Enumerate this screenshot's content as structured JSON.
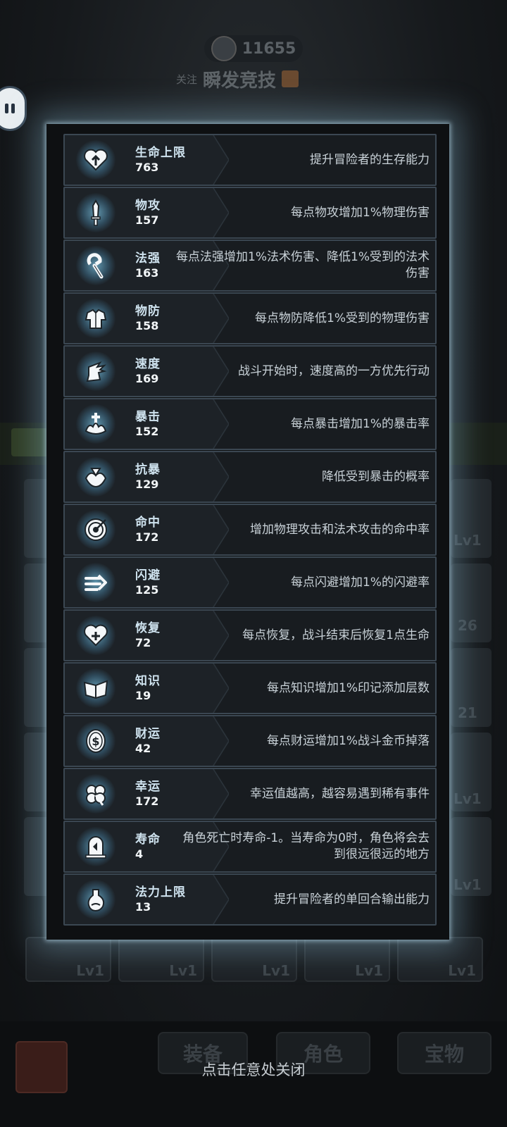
{
  "background": {
    "coins": "11655",
    "follow_label": "关注",
    "mode_name": "瞬发竞技",
    "slot_levels": [
      "Lv1",
      "26",
      "21",
      "Lv1",
      "Lv1"
    ],
    "bottom_row_levels": [
      "Lv1",
      "Lv1",
      "Lv1",
      "Lv1",
      "Lv1"
    ],
    "nav_tabs": [
      "装备",
      "角色",
      "宝物"
    ]
  },
  "stats": [
    {
      "icon": "heart-up-icon",
      "name": "生命上限",
      "value": "763",
      "desc": "提升冒险者的生存能力"
    },
    {
      "icon": "sword-icon",
      "name": "物攻",
      "value": "157",
      "desc": "每点物攻增加1%物理伤害"
    },
    {
      "icon": "staff-icon",
      "name": "法强",
      "value": "163",
      "desc": "每点法强增加1%法术伤害、降低1%受到的法术伤害"
    },
    {
      "icon": "armor-icon",
      "name": "物防",
      "value": "158",
      "desc": "每点物防降低1%受到的物理伤害"
    },
    {
      "icon": "winged-boot-icon",
      "name": "速度",
      "value": "169",
      "desc": "战斗开始时，速度高的一方优先行动"
    },
    {
      "icon": "crit-icon",
      "name": "暴击",
      "value": "152",
      "desc": "每点暴击增加1%的暴击率"
    },
    {
      "icon": "crit-resist-icon",
      "name": "抗暴",
      "value": "129",
      "desc": "降低受到暴击的概率"
    },
    {
      "icon": "target-icon",
      "name": "命中",
      "value": "172",
      "desc": "增加物理攻击和法术攻击的命中率"
    },
    {
      "icon": "dodge-icon",
      "name": "闪避",
      "value": "125",
      "desc": "每点闪避增加1%的闪避率"
    },
    {
      "icon": "heart-plus-icon",
      "name": "恢复",
      "value": "72",
      "desc": "每点恢复，战斗结束后恢复1点生命"
    },
    {
      "icon": "book-icon",
      "name": "知识",
      "value": "19",
      "desc": "每点知识增加1%印记添加层数"
    },
    {
      "icon": "gold-coin-icon",
      "name": "财运",
      "value": "42",
      "desc": "每点财运增加1%战斗金币掉落"
    },
    {
      "icon": "clover-icon",
      "name": "幸运",
      "value": "172",
      "desc": "幸运值越高，越容易遇到稀有事件"
    },
    {
      "icon": "tombstone-icon",
      "name": "寿命",
      "value": "4",
      "desc": "角色死亡时寿命-1。当寿命为0时，角色将会去到很远很远的地方"
    },
    {
      "icon": "mana-flask-icon",
      "name": "法力上限",
      "value": "13",
      "desc": "提升冒险者的单回合输出能力"
    }
  ],
  "close_hint": "点击任意处关闭"
}
